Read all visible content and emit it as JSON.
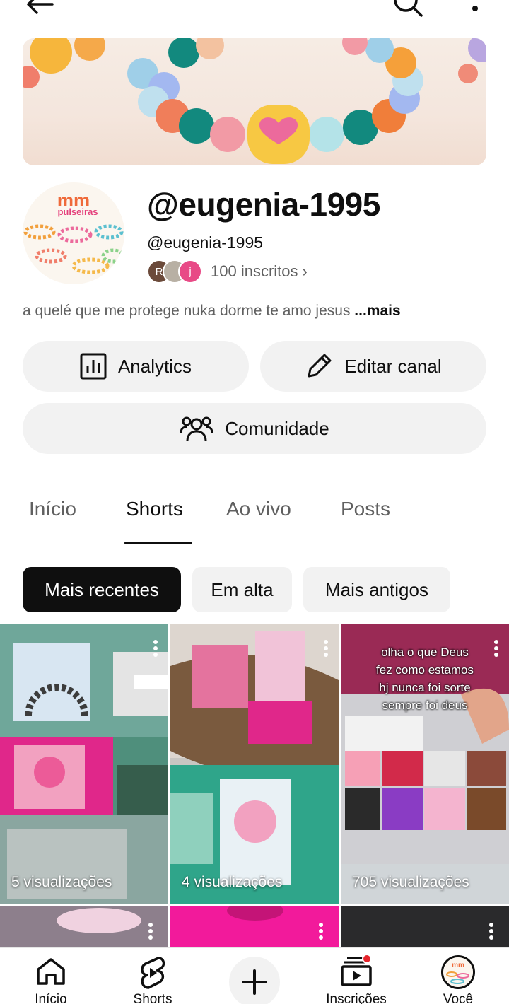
{
  "topbar": {
    "back_icon": "arrow-left-icon",
    "search_icon": "search-icon",
    "more_icon": "more-vertical-icon"
  },
  "channel": {
    "title": "@eugenia-1995",
    "handle": "@eugenia-1995",
    "avatar_logo_text": "mm",
    "avatar_logo_sub": "pulseiras",
    "subscriber_avatars": [
      "R",
      "",
      "j"
    ],
    "subscribers": "100 inscritos",
    "description": "a quelé que me protege nuka dorme te amo jesus ",
    "description_more": "...mais"
  },
  "actions": {
    "analytics": "Analytics",
    "edit": "Editar canal",
    "community": "Comunidade"
  },
  "tabs": [
    {
      "label": "Início",
      "active": false
    },
    {
      "label": "Shorts",
      "active": true
    },
    {
      "label": "Ao vivo",
      "active": false
    },
    {
      "label": "Posts",
      "active": false
    }
  ],
  "filters": [
    {
      "label": "Mais recentes",
      "selected": true
    },
    {
      "label": "Em alta",
      "selected": false
    },
    {
      "label": "Mais antigos",
      "selected": false
    }
  ],
  "shorts": [
    {
      "views": "5 visualizações",
      "overlay": ""
    },
    {
      "views": "4 visualizações",
      "overlay": ""
    },
    {
      "views": "705 visualizações",
      "overlay": "olha o que Deus\nfez como estamos\nhj nunca foi sorte\nsempre foi deus"
    }
  ],
  "bottom_nav": {
    "home": "Início",
    "shorts": "Shorts",
    "create_icon": "plus-icon",
    "subscriptions": "Inscrições",
    "you": "Você"
  },
  "colors": {
    "accent_red": "#e5232b",
    "chip_selected": "#0f0f0f",
    "pill_bg": "#f2f2f2",
    "secondary_text": "#606060"
  }
}
